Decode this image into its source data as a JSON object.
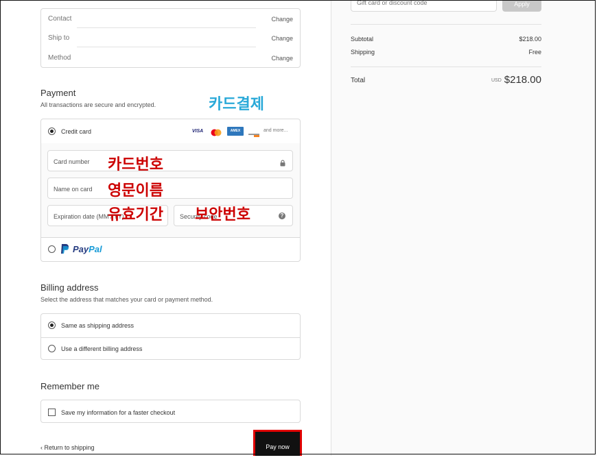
{
  "review": {
    "rows": [
      {
        "label": "Contact",
        "action": "Change"
      },
      {
        "label": "Ship to",
        "action": "Change"
      },
      {
        "label": "Method",
        "action": "Change"
      }
    ]
  },
  "payment": {
    "title": "Payment",
    "subtitle": "All transactions are secure and encrypted.",
    "credit_card_label": "Credit card",
    "card_logos": [
      "VISA",
      "mastercard",
      "AMEX",
      "discover"
    ],
    "more_label": "and more...",
    "fields": {
      "card_number": "Card number",
      "name_on_card": "Name on card",
      "expiration": "Expiration date (MM / YY)",
      "security_code": "Security code"
    },
    "paypal_label_a": "Pay",
    "paypal_label_b": "Pal"
  },
  "annotations": {
    "card_payment": "카드결제",
    "card_number": "카드번호",
    "english_name": "영문이름",
    "expiry": "유효기간",
    "security_code": "보안번호"
  },
  "billing": {
    "title": "Billing address",
    "subtitle": "Select the address that matches your card or payment method.",
    "options": [
      "Same as shipping address",
      "Use a different billing address"
    ],
    "selected_index": 0
  },
  "remember": {
    "title": "Remember me",
    "checkbox_label": "Save my information for a faster checkout",
    "checked": false
  },
  "footer": {
    "return_label": "Return to shipping",
    "pay_label": "Pay now"
  },
  "summary": {
    "gift_placeholder": "Gift card or discount code",
    "apply_label": "Apply",
    "subtotal_label": "Subtotal",
    "subtotal_value": "$218.00",
    "shipping_label": "Shipping",
    "shipping_value": "Free",
    "total_label": "Total",
    "total_currency": "USD",
    "total_value": "$218.00"
  },
  "colors": {
    "annotation_red": "#cc0000",
    "annotation_blue": "#29a9d8",
    "highlight_border": "#e00000",
    "pay_button": "#111111"
  }
}
